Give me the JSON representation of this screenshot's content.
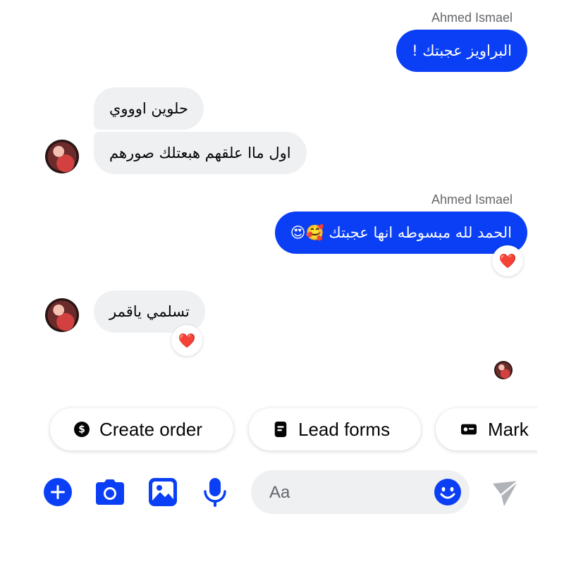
{
  "messages": [
    {
      "sender": "Ahmed Ismael",
      "text": "البراويز عجبتك !"
    },
    {
      "text": "حلوين اوووي"
    },
    {
      "text": "اول ماا علقهم هبعتلك صورهم"
    },
    {
      "sender": "Ahmed Ismael",
      "text": "الحمد لله مبسوطه انها عجبتك 🥰😍",
      "reaction": "❤️"
    },
    {
      "text": "تسلمي ياقمر",
      "reaction": "❤️"
    }
  ],
  "quick_actions": [
    {
      "label": "Create order",
      "icon": "dollar-circle-icon"
    },
    {
      "label": "Lead forms",
      "icon": "form-document-icon"
    },
    {
      "label": "Mark",
      "icon": "label-card-icon"
    }
  ],
  "composer": {
    "placeholder": "Aa",
    "icons": [
      "plus-icon",
      "camera-icon",
      "image-icon",
      "microphone-icon",
      "emoji-icon",
      "send-icon"
    ]
  },
  "colors": {
    "accent": "#0a3ff5",
    "incoming_bubble": "#eff0f2",
    "sender_label": "#65676b",
    "send_disabled": "#b0b3b8"
  }
}
